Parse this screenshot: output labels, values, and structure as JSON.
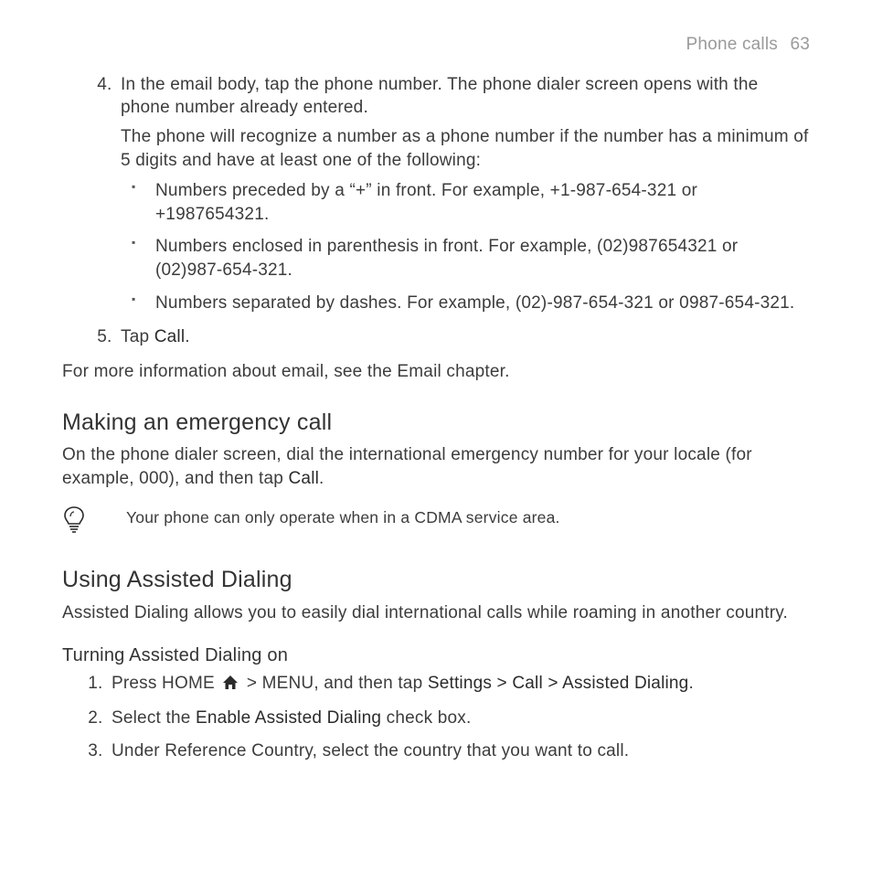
{
  "header": {
    "section": "Phone calls",
    "page": "63"
  },
  "list1": {
    "start": 4,
    "item4": {
      "p1": "In the email body, tap the phone number. The phone dialer screen opens with the phone number already entered.",
      "p2": "The phone will recognize a number as a phone number if the number has a minimum of 5 digits and have at least one of the following:",
      "b1": "Numbers preceded by a “+” in front. For example, +1-987-654-321 or +1987654321.",
      "b2": "Numbers enclosed in parenthesis in front. For example, (02)987654321 or (02)987-654-321.",
      "b3": "Numbers separated by dashes. For example, (02)-987-654-321 or 0987-654-321."
    },
    "item5": {
      "pre": "Tap ",
      "bold": "Call",
      "post": "."
    }
  },
  "para_more": "For more information about email, see the Email chapter.",
  "emergency": {
    "heading": "Making an emergency call",
    "t1": "On the phone dialer screen, dial the international emergency number for your locale (for example, 000), and then tap ",
    "t1b": "Call",
    "t1c": ".",
    "tip": "Your phone can only operate when in a CDMA service area."
  },
  "assisted": {
    "heading": "Using Assisted Dialing",
    "intro": "Assisted Dialing allows you to easily dial international calls while roaming in another country.",
    "sub": "Turning Assisted Dialing on",
    "s1": {
      "a": "Press HOME ",
      "b": "> MENU, and then tap ",
      "c": "Settings > Call > Assisted Dialing",
      "d": "."
    },
    "s2": {
      "a": "Select the ",
      "b": "Enable Assisted Dialing",
      "c": " check box."
    },
    "s3": "Under Reference Country, select the country that you want to call."
  }
}
